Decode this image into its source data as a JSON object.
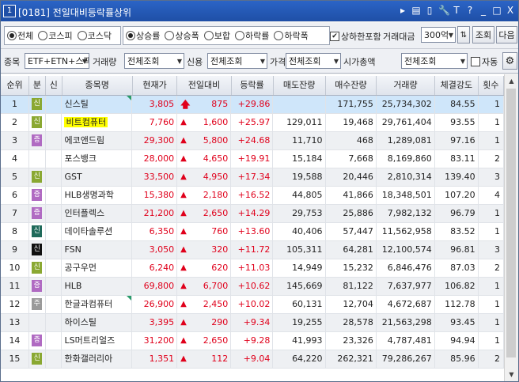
{
  "window": {
    "number": "1",
    "title": "[0181] 전일대비등락률상위",
    "controls": [
      "▸",
      "▤",
      "▯",
      "🔧",
      "T",
      "?",
      "_",
      "□",
      "X"
    ]
  },
  "filters": {
    "market_options": [
      "전체",
      "코스피",
      "코스닥"
    ],
    "market_selected": "전체",
    "type_options": [
      "상승률",
      "상승폭",
      "보합",
      "하락률",
      "하락폭"
    ],
    "type_selected": "상승률",
    "limit_checkbox_label": "상하한포함",
    "limit_checked": true,
    "trade_amount_label": "거래대금",
    "trade_amount_value": "300억",
    "query_button": "조회",
    "next_button": "다음",
    "item_label": "종목",
    "item_value": "ETF+ETN+스팩",
    "volume_label": "거래량",
    "volume_value": "전체조회",
    "credit_label": "신용",
    "credit_value": "전체조회",
    "price_label": "가격",
    "price_value": "전체조회",
    "marketcap_label": "시가총액",
    "marketcap_value": "전체조회",
    "auto_label": "자동",
    "auto_checked": false
  },
  "table": {
    "headers": [
      "순위",
      "분",
      "신",
      "종목명",
      "현재가",
      "전일대비",
      "등락률",
      "매도잔량",
      "매수잔량",
      "거래량",
      "체결강도",
      "횟수"
    ],
    "badge_colors": {
      "신": "#8aa832",
      "증": "#b06ac2",
      "주": "#9a9a9a",
      "신B": "#1f6a5a",
      "신K": "#111111"
    },
    "rows": [
      {
        "rank": "1",
        "div": "신",
        "divc": "#8aa832",
        "new": "",
        "name": "신스틸",
        "price": "3,805",
        "sign": "up",
        "change": "875",
        "rate": "+29.86",
        "ask": "",
        "bid": "171,755",
        "volume": "25,734,302",
        "strength": "84.55",
        "count": "1",
        "flag": true,
        "highlight": false
      },
      {
        "rank": "2",
        "div": "신",
        "divc": "#8aa832",
        "new": "",
        "name": "비트컴퓨터",
        "price": "7,760",
        "sign": "tri",
        "change": "1,600",
        "rate": "+25.97",
        "ask": "129,011",
        "bid": "19,468",
        "volume": "29,761,404",
        "strength": "93.55",
        "count": "1",
        "flag": false,
        "highlight": true
      },
      {
        "rank": "3",
        "div": "증",
        "divc": "#b06ac2",
        "new": "",
        "name": "에코앤드림",
        "price": "29,300",
        "sign": "tri",
        "change": "5,800",
        "rate": "+24.68",
        "ask": "11,710",
        "bid": "468",
        "volume": "1,289,081",
        "strength": "97.16",
        "count": "1",
        "flag": false,
        "highlight": false
      },
      {
        "rank": "4",
        "div": "",
        "divc": "",
        "new": "",
        "name": "포스뱅크",
        "price": "28,000",
        "sign": "tri",
        "change": "4,650",
        "rate": "+19.91",
        "ask": "15,184",
        "bid": "7,668",
        "volume": "8,169,860",
        "strength": "83.11",
        "count": "2",
        "flag": false,
        "highlight": false
      },
      {
        "rank": "5",
        "div": "신",
        "divc": "#8aa832",
        "new": "",
        "name": "GST",
        "price": "33,500",
        "sign": "tri",
        "change": "4,950",
        "rate": "+17.34",
        "ask": "19,588",
        "bid": "20,446",
        "volume": "2,810,314",
        "strength": "139.40",
        "count": "3",
        "flag": false,
        "highlight": false
      },
      {
        "rank": "6",
        "div": "증",
        "divc": "#b06ac2",
        "new": "",
        "name": "HLB생명과학",
        "price": "15,380",
        "sign": "tri",
        "change": "2,180",
        "rate": "+16.52",
        "ask": "44,805",
        "bid": "41,866",
        "volume": "18,348,501",
        "strength": "107.20",
        "count": "4",
        "flag": false,
        "highlight": false
      },
      {
        "rank": "7",
        "div": "증",
        "divc": "#b06ac2",
        "new": "",
        "name": "인터플렉스",
        "price": "21,200",
        "sign": "tri",
        "change": "2,650",
        "rate": "+14.29",
        "ask": "29,753",
        "bid": "25,886",
        "volume": "7,982,132",
        "strength": "96.79",
        "count": "1",
        "flag": false,
        "highlight": false
      },
      {
        "rank": "8",
        "div": "신",
        "divc": "#1f6a5a",
        "new": "",
        "name": "데이타솔루션",
        "price": "6,350",
        "sign": "tri",
        "change": "760",
        "rate": "+13.60",
        "ask": "40,406",
        "bid": "57,447",
        "volume": "11,562,958",
        "strength": "83.52",
        "count": "1",
        "flag": false,
        "highlight": false
      },
      {
        "rank": "9",
        "div": "신",
        "divc": "#111111",
        "new": "",
        "name": "FSN",
        "price": "3,050",
        "sign": "tri",
        "change": "320",
        "rate": "+11.72",
        "ask": "105,311",
        "bid": "64,281",
        "volume": "12,100,574",
        "strength": "96.81",
        "count": "3",
        "flag": false,
        "highlight": false
      },
      {
        "rank": "10",
        "div": "신",
        "divc": "#8aa832",
        "new": "",
        "name": "공구우먼",
        "price": "6,240",
        "sign": "tri",
        "change": "620",
        "rate": "+11.03",
        "ask": "14,949",
        "bid": "15,232",
        "volume": "6,846,476",
        "strength": "87.03",
        "count": "2",
        "flag": false,
        "highlight": false
      },
      {
        "rank": "11",
        "div": "증",
        "divc": "#b06ac2",
        "new": "",
        "name": "HLB",
        "price": "69,800",
        "sign": "tri",
        "change": "6,700",
        "rate": "+10.62",
        "ask": "145,669",
        "bid": "81,122",
        "volume": "7,637,977",
        "strength": "106.82",
        "count": "1",
        "flag": false,
        "highlight": false
      },
      {
        "rank": "12",
        "div": "주",
        "divc": "#9a9a9a",
        "new": "",
        "name": "한글과컴퓨터",
        "price": "26,900",
        "sign": "tri",
        "change": "2,450",
        "rate": "+10.02",
        "ask": "60,131",
        "bid": "12,704",
        "volume": "4,672,687",
        "strength": "112.78",
        "count": "1",
        "flag": true,
        "highlight": false
      },
      {
        "rank": "13",
        "div": "",
        "divc": "",
        "new": "",
        "name": "하이스틸",
        "price": "3,395",
        "sign": "tri",
        "change": "290",
        "rate": "+9.34",
        "ask": "19,255",
        "bid": "28,578",
        "volume": "21,563,298",
        "strength": "93.45",
        "count": "1",
        "flag": false,
        "highlight": false
      },
      {
        "rank": "14",
        "div": "증",
        "divc": "#b06ac2",
        "new": "",
        "name": "LS머트리얼즈",
        "price": "31,200",
        "sign": "tri",
        "change": "2,650",
        "rate": "+9.28",
        "ask": "41,993",
        "bid": "23,326",
        "volume": "4,787,481",
        "strength": "94.94",
        "count": "1",
        "flag": false,
        "highlight": false
      },
      {
        "rank": "15",
        "div": "신",
        "divc": "#8aa832",
        "new": "",
        "name": "한화갤러리아",
        "price": "1,351",
        "sign": "tri",
        "change": "112",
        "rate": "+9.04",
        "ask": "64,220",
        "bid": "262,321",
        "volume": "79,286,267",
        "strength": "85.96",
        "count": "2",
        "flag": false,
        "highlight": false
      }
    ]
  }
}
